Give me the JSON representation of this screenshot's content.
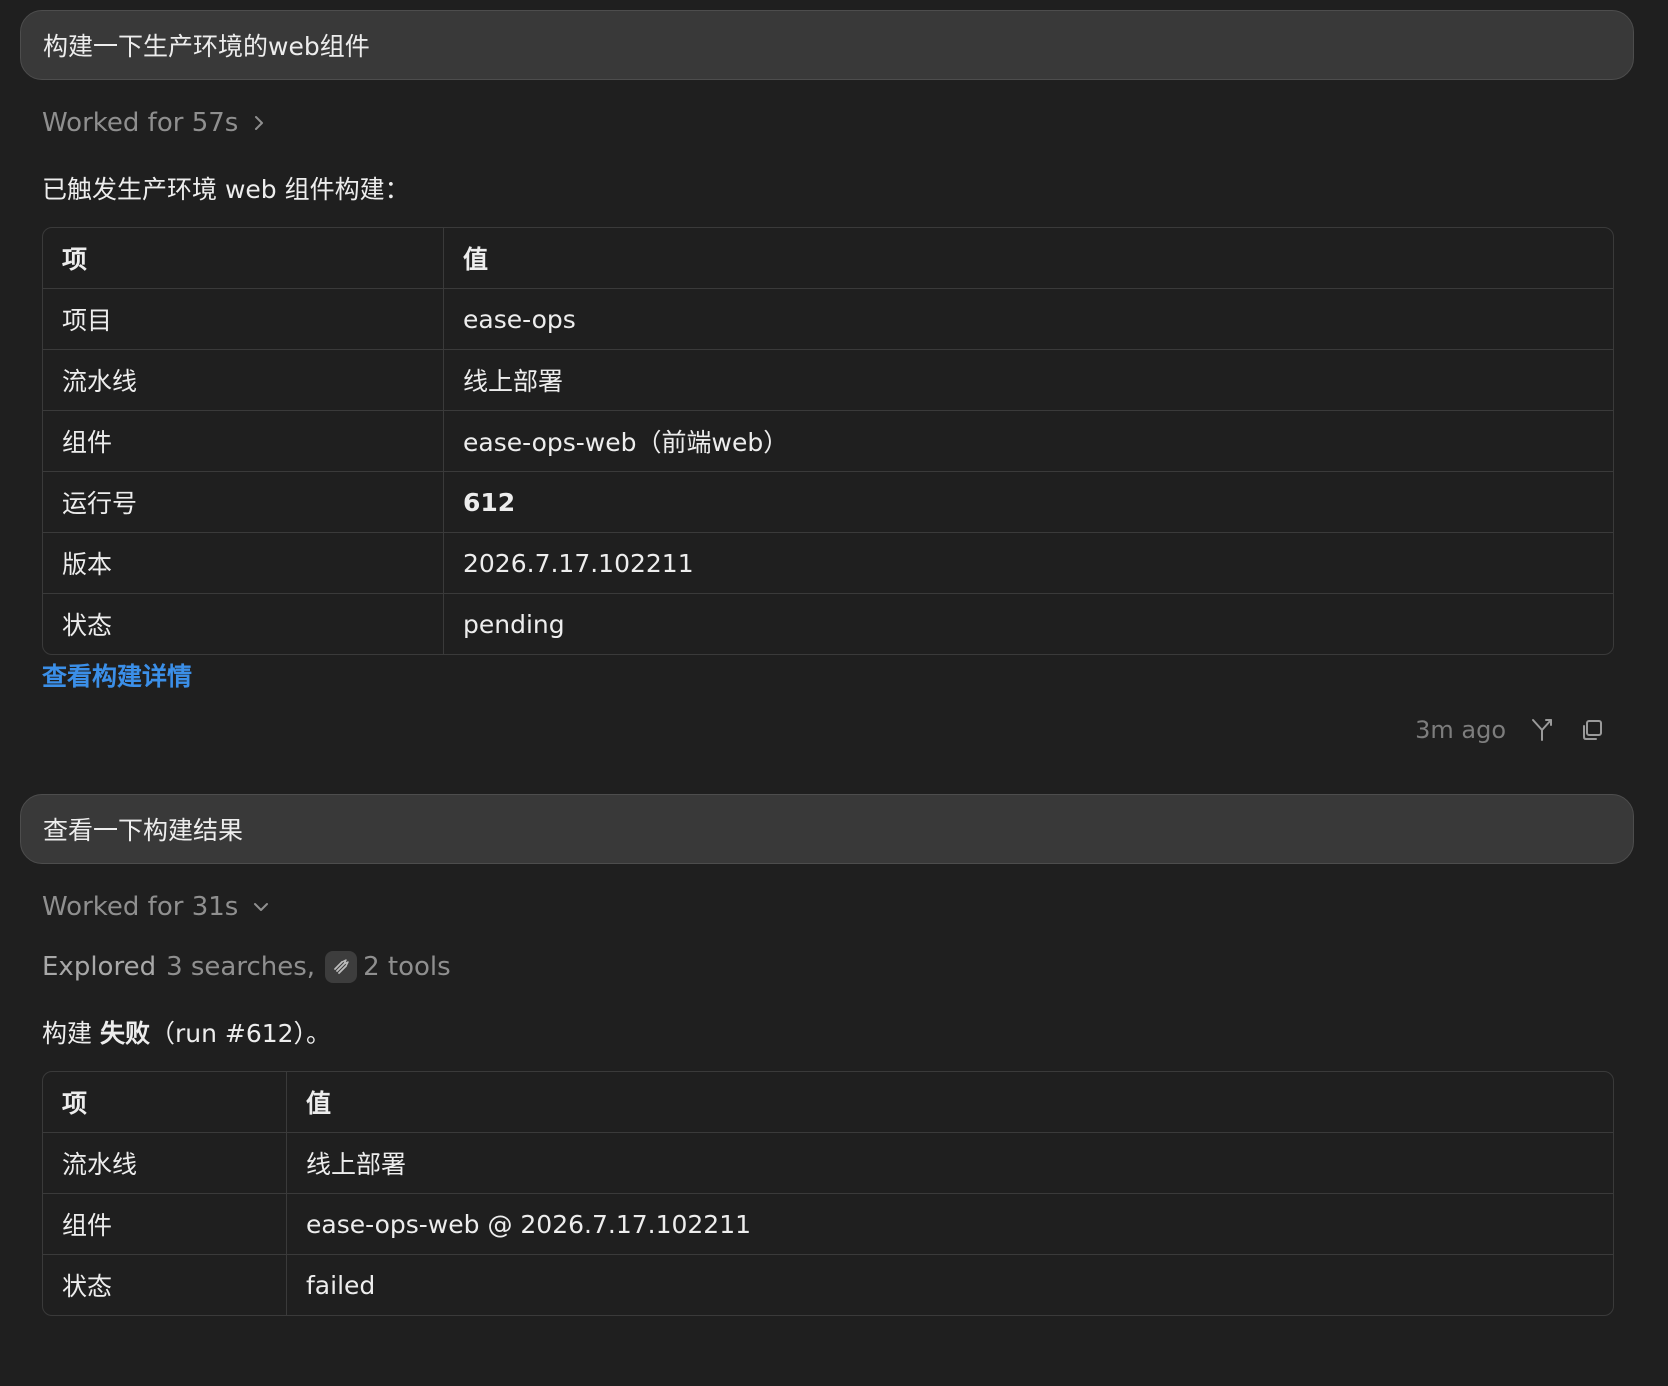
{
  "conversation": {
    "turn1": {
      "user_message": "构建一下生产环境的web组件",
      "worked_label": "Worked for 57s",
      "intro": "已触发生产环境 web 组件构建：",
      "table": {
        "headers": [
          "项",
          "值"
        ],
        "rows": [
          {
            "key": "项目",
            "value": "ease-ops"
          },
          {
            "key": "流水线",
            "value": "线上部署"
          },
          {
            "key": "组件",
            "value": "ease-ops-web（前端web）"
          },
          {
            "key": "运行号",
            "value": "612"
          },
          {
            "key": "版本",
            "value": "2026.7.17.102211"
          },
          {
            "key": "状态",
            "value": "pending"
          }
        ]
      },
      "link_text": "查看构建详情",
      "timestamp": "3m ago",
      "actions": {
        "fork_icon": "fork-icon",
        "copy_icon": "copy-icon"
      }
    },
    "turn2": {
      "user_message": "查看一下构建结果",
      "worked_label": "Worked for 31s",
      "explored": {
        "label": "Explored",
        "searches": "3 searches,",
        "tools_icon": "tools-icon",
        "tools": "2 tools"
      },
      "summary": {
        "prefix": "构建 ",
        "status_word": "失败",
        "suffix": "（run #612）。"
      },
      "table": {
        "headers": [
          "项",
          "值"
        ],
        "rows": [
          {
            "key": "流水线",
            "value": "线上部署"
          },
          {
            "key": "组件",
            "value": "ease-ops-web @ 2026.7.17.102211"
          },
          {
            "key": "状态",
            "value": "failed"
          }
        ]
      }
    }
  },
  "colors": {
    "background": "#1f1f1f",
    "bubble": "#393939",
    "link": "#3b8fe8",
    "muted_text": "#8f8f8f"
  }
}
